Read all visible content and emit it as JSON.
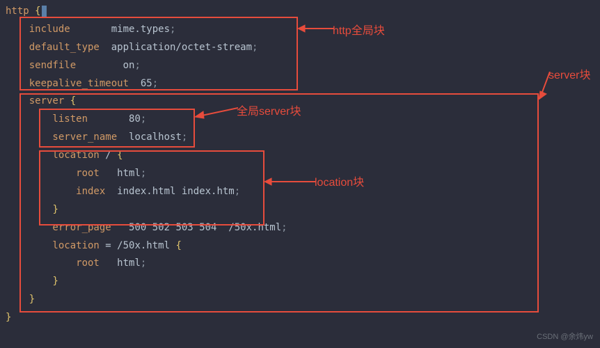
{
  "code": {
    "l1a": "http ",
    "l1b": "{",
    "l2a": "    include       ",
    "l2b": "mime.types",
    "l2c": ";",
    "l3a": "    default_type  ",
    "l3b": "application/octet-stream",
    "l3c": ";",
    "l4a": "    sendfile        ",
    "l4b": "on",
    "l4c": ";",
    "l5a": "    keepalive_timeout  ",
    "l5b": "65",
    "l5c": ";",
    "l6a": "    server ",
    "l6b": "{",
    "l7a": "        listen       ",
    "l7b": "80",
    "l7c": ";",
    "l8a": "        server_name  ",
    "l8b": "localhost",
    "l8c": ";",
    "l9a": "        location ",
    "l9b": "/ ",
    "l9c": "{",
    "l10a": "            root   ",
    "l10b": "html",
    "l10c": ";",
    "l11a": "            index  ",
    "l11b": "index.html index.htm",
    "l11c": ";",
    "l12a": "        ",
    "l12b": "}",
    "l13a": "        error_page   ",
    "l13b": "500 502 503 504  /50x.html",
    "l13c": ";",
    "l14a": "        location ",
    "l14b": "= /50x.html ",
    "l14c": "{",
    "l15a": "            root   ",
    "l15b": "html",
    "l15c": ";",
    "l16a": "        ",
    "l16b": "}",
    "l17a": "    ",
    "l17b": "}",
    "l18a": "",
    "l18b": "}"
  },
  "labels": {
    "http_global": "http全局块",
    "server_block": "server块",
    "global_server": "全局server块",
    "location_block": "location块"
  },
  "watermark": "CSDN @余炜yw"
}
